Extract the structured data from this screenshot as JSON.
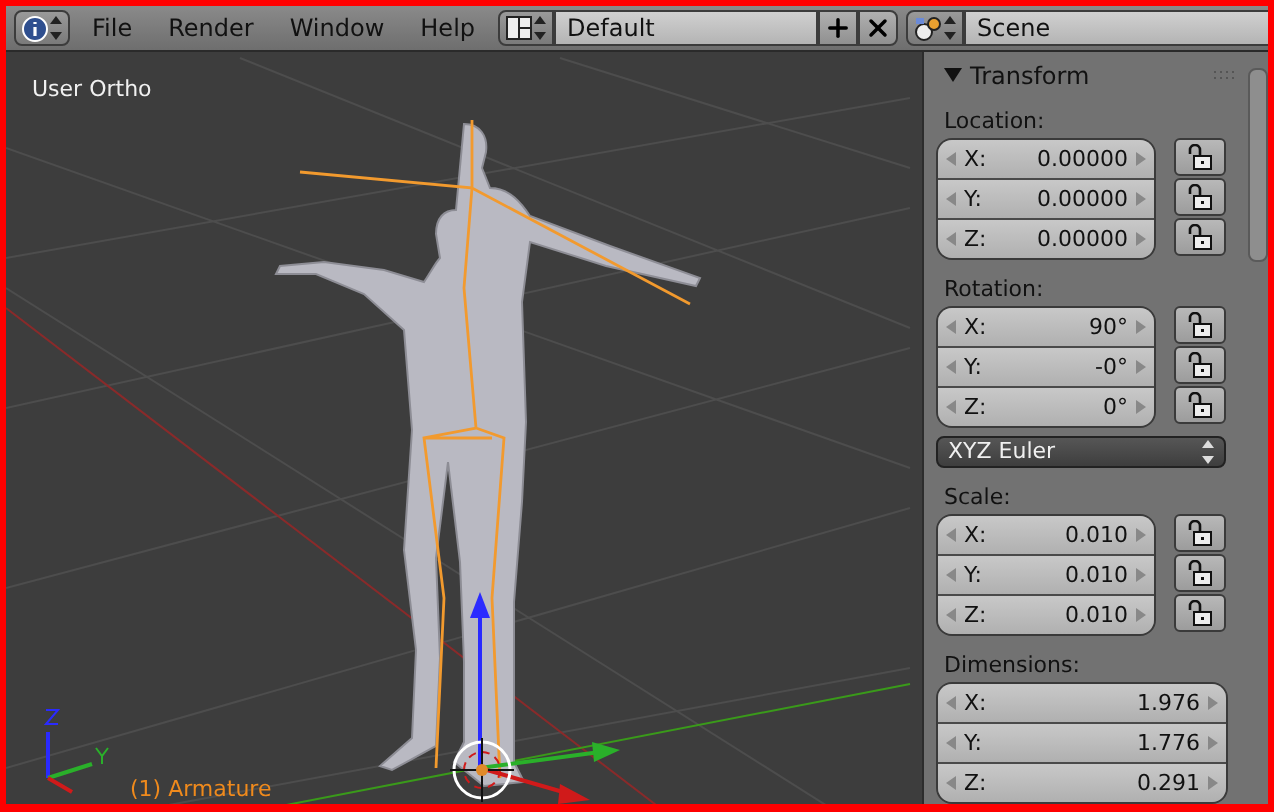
{
  "header": {
    "menus": [
      "File",
      "Render",
      "Window",
      "Help"
    ],
    "layout_field": "Default",
    "scene_field": "Scene"
  },
  "viewport": {
    "view_label": "User Ortho",
    "object_label": "(1) Armature"
  },
  "panel": {
    "title": "Transform",
    "expanded": true,
    "groups": [
      {
        "label": "Location:",
        "kind": "locked",
        "fields": [
          {
            "axis": "X:",
            "value": "0.00000",
            "locked": false
          },
          {
            "axis": "Y:",
            "value": "0.00000",
            "locked": false
          },
          {
            "axis": "Z:",
            "value": "0.00000",
            "locked": false
          }
        ]
      },
      {
        "label": "Rotation:",
        "kind": "locked",
        "fields": [
          {
            "axis": "X:",
            "value": "90°",
            "locked": false
          },
          {
            "axis": "Y:",
            "value": "-0°",
            "locked": false
          },
          {
            "axis": "Z:",
            "value": "0°",
            "locked": false
          }
        ]
      },
      {
        "kind": "select",
        "value": "XYZ Euler"
      },
      {
        "label": "Scale:",
        "kind": "locked",
        "fields": [
          {
            "axis": "X:",
            "value": "0.010",
            "locked": false
          },
          {
            "axis": "Y:",
            "value": "0.010",
            "locked": false
          },
          {
            "axis": "Z:",
            "value": "0.010",
            "locked": false
          }
        ]
      },
      {
        "label": "Dimensions:",
        "kind": "plain",
        "fields": [
          {
            "axis": "X:",
            "value": "1.976"
          },
          {
            "axis": "Y:",
            "value": "1.776"
          },
          {
            "axis": "Z:",
            "value": "0.291"
          }
        ]
      }
    ]
  }
}
